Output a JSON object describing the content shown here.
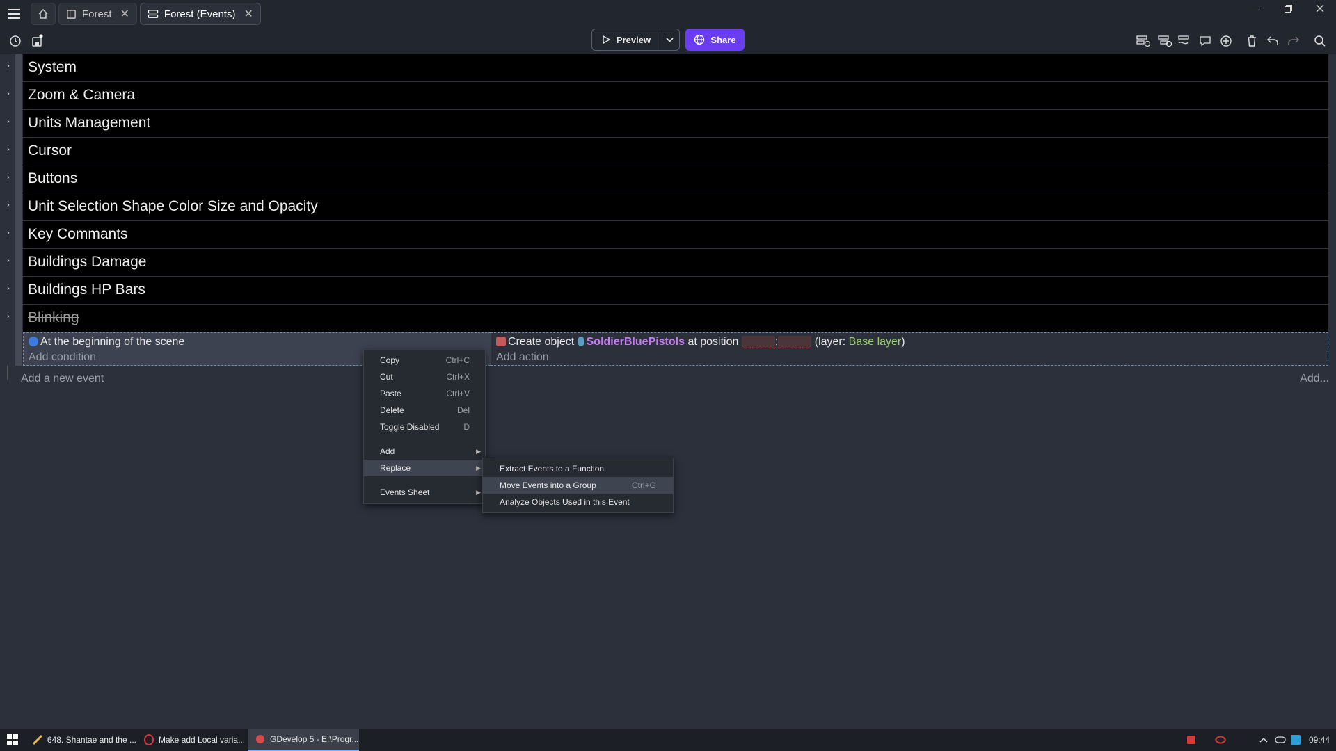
{
  "titlebar": {
    "tabs": [
      {
        "label": "Forest",
        "icon": "scene-icon"
      },
      {
        "label": "Forest (Events)",
        "icon": "events-icon"
      }
    ],
    "close_glyph": "✕"
  },
  "toolbar": {
    "preview_label": "Preview",
    "share_label": "Share"
  },
  "event_groups": [
    {
      "title": "System"
    },
    {
      "title": "Zoom & Camera"
    },
    {
      "title": "Units Management"
    },
    {
      "title": "Cursor"
    },
    {
      "title": "Buttons"
    },
    {
      "title": "Unit Selection Shape Color Size and Opacity"
    },
    {
      "title": "Key Commants"
    },
    {
      "title": "Buildings Damage"
    },
    {
      "title": "Buildings HP Bars"
    },
    {
      "title": "Blinking",
      "disabled": true
    }
  ],
  "event": {
    "condition": "At the beginning of the scene",
    "add_condition": "Add condition",
    "action_prefix": "Create object",
    "action_object": "SoldierBluePistols",
    "action_mid": "at position",
    "action_sep": ";",
    "action_layer_prefix": "(layer:",
    "action_layer": "Base layer",
    "action_layer_suffix": ")",
    "add_action": "Add action"
  },
  "add_event_label": "Add a new event",
  "add_more_label": "Add...",
  "context_menu": {
    "items": [
      {
        "label": "Copy",
        "shortcut": "Ctrl+C"
      },
      {
        "label": "Cut",
        "shortcut": "Ctrl+X"
      },
      {
        "label": "Paste",
        "shortcut": "Ctrl+V"
      },
      {
        "label": "Delete",
        "shortcut": "Del"
      },
      {
        "label": "Toggle Disabled",
        "shortcut": "D"
      }
    ],
    "add_label": "Add",
    "replace_label": "Replace",
    "events_sheet_label": "Events Sheet"
  },
  "submenu": {
    "items": [
      {
        "label": "Extract Events to a Function",
        "shortcut": ""
      },
      {
        "label": "Move Events into a Group",
        "shortcut": "Ctrl+G"
      },
      {
        "label": "Analyze Objects Used in this Event",
        "shortcut": ""
      }
    ]
  },
  "taskbar": {
    "tasks": [
      {
        "label": "648. Shantae and the ..."
      },
      {
        "label": "Make add Local varia..."
      },
      {
        "label": "GDevelop 5 - E:\\Progr..."
      }
    ],
    "clock": "09:44"
  },
  "colors": {
    "accent": "#6b3df0",
    "object": "#c57cf0",
    "layer": "#9ccf6b"
  }
}
